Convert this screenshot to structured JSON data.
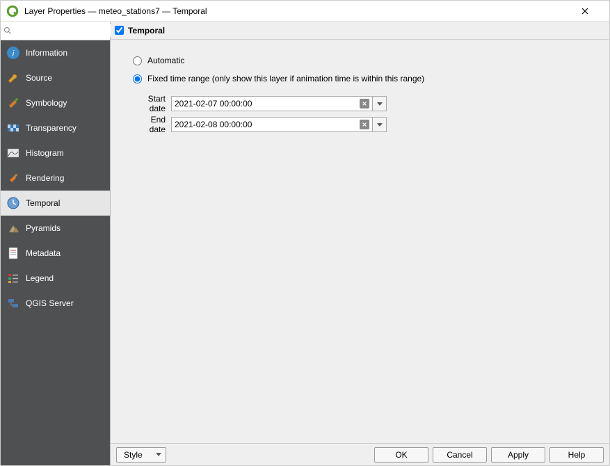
{
  "window": {
    "title": "Layer Properties — meteo_stations7 — Temporal"
  },
  "search": {
    "placeholder": ""
  },
  "sidebar": {
    "items": [
      {
        "id": "information",
        "label": "Information"
      },
      {
        "id": "source",
        "label": "Source"
      },
      {
        "id": "symbology",
        "label": "Symbology"
      },
      {
        "id": "transparency",
        "label": "Transparency"
      },
      {
        "id": "histogram",
        "label": "Histogram"
      },
      {
        "id": "rendering",
        "label": "Rendering"
      },
      {
        "id": "temporal",
        "label": "Temporal",
        "active": true
      },
      {
        "id": "pyramids",
        "label": "Pyramids"
      },
      {
        "id": "metadata",
        "label": "Metadata"
      },
      {
        "id": "legend",
        "label": "Legend"
      },
      {
        "id": "qgis-server",
        "label": "QGIS Server"
      }
    ]
  },
  "panel": {
    "header_label": "Temporal",
    "header_checked": true,
    "radio_auto_label": "Automatic",
    "radio_fixed_label": "Fixed time range (only show this layer if animation time is within this range)",
    "selected_mode": "fixed",
    "start_label": "Start date",
    "end_label": "End date",
    "start_value": "2021-02-07 00:00:00",
    "end_value": "2021-02-08 00:00:00"
  },
  "footer": {
    "style_label": "Style",
    "ok_label": "OK",
    "cancel_label": "Cancel",
    "apply_label": "Apply",
    "help_label": "Help"
  }
}
